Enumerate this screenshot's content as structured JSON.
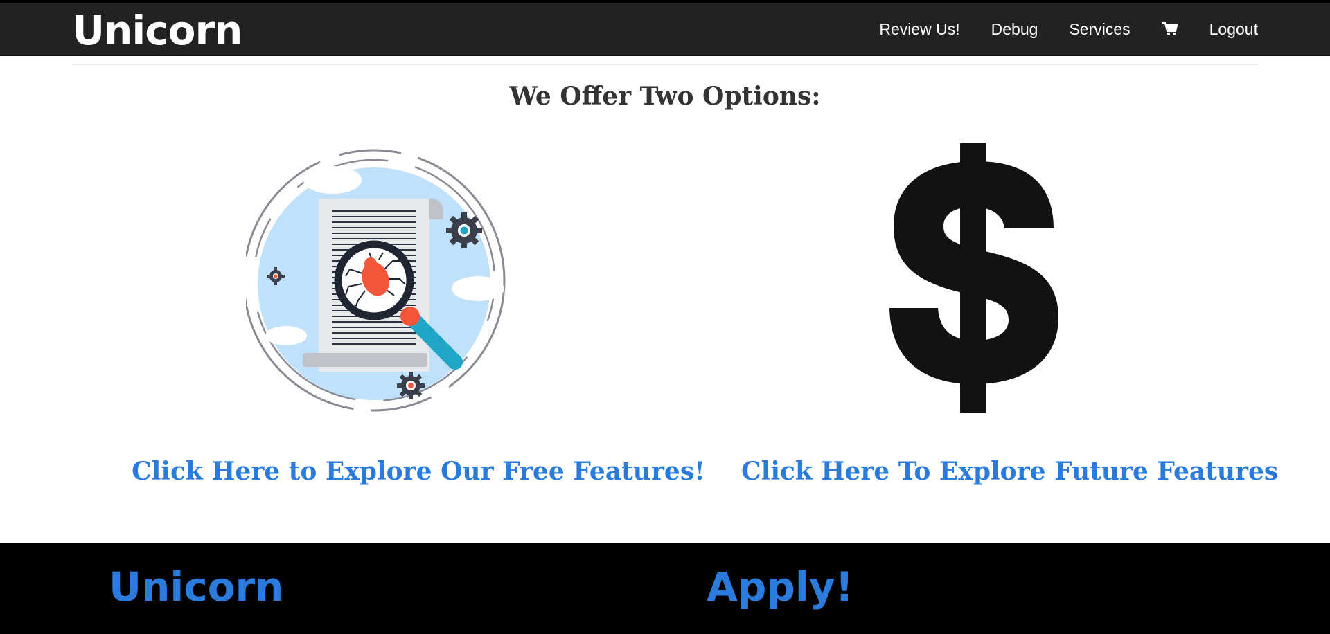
{
  "brand": {
    "name": "Unicorn"
  },
  "nav": {
    "items": [
      "Review Us!",
      "Debug",
      "Services"
    ],
    "cart_icon": "cart-icon",
    "logout": "Logout"
  },
  "main": {
    "heading": "We Offer Two Options:",
    "options": [
      {
        "image": "bug-search-illustration",
        "link_text": "Click Here to Explore Our Free Features!"
      },
      {
        "image": "dollar-sign-icon",
        "link_text": "Click Here To Explore Future Features"
      }
    ]
  },
  "footer": {
    "left_title": "Unicorn",
    "right_title": "Apply!"
  },
  "colors": {
    "navbar_bg": "#222222",
    "link_blue": "#2a7bdc",
    "footer_bg": "#000000"
  }
}
